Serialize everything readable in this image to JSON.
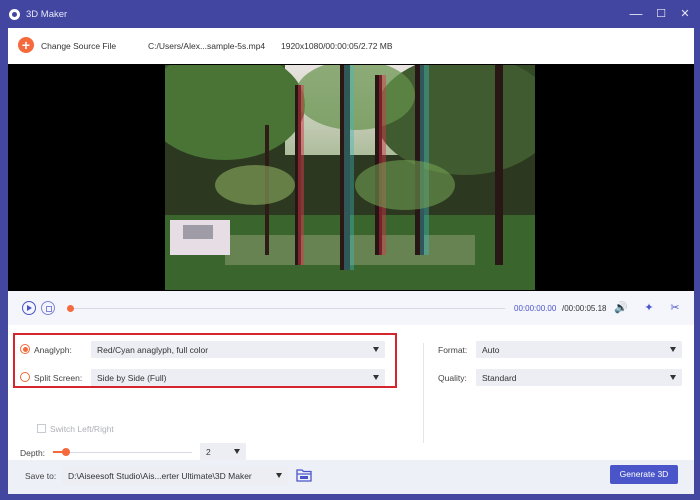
{
  "window": {
    "title": "3D Maker",
    "minimize_glyph": "—",
    "maximize_glyph": "☐",
    "close_glyph": "✕"
  },
  "toolbar": {
    "add_glyph": "+",
    "change_source_label": "Change Source File",
    "file_path": "C:/Users/Alex...sample-5s.mp4",
    "file_info": "1920x1080/00:00:05/2.72 MB"
  },
  "player": {
    "current_time": "00:00:00.00",
    "total_time": "/00:00:05.18",
    "progress": 0,
    "volume_glyph": "🔊",
    "effects_glyph": "✦",
    "cut_glyph": "✂"
  },
  "settings": {
    "anaglyph": {
      "label": "Anaglyph:",
      "selected": true,
      "value": "Red/Cyan anaglyph, full color"
    },
    "split_screen": {
      "label": "Split Screen:",
      "selected": false,
      "value": "Side by Side (Full)"
    },
    "switch_left_right": {
      "label": "Switch Left/Right",
      "checked": false,
      "enabled": false
    },
    "depth": {
      "label": "Depth:",
      "value": "2"
    },
    "format": {
      "label": "Format:",
      "value": "Auto"
    },
    "quality": {
      "label": "Quality:",
      "value": "Standard"
    }
  },
  "footer": {
    "save_to_label": "Save to:",
    "save_path": "D:\\Aiseesoft Studio\\Ais...erter Ultimate\\3D Maker",
    "generate_label": "Generate 3D"
  },
  "colors": {
    "accent": "#4a55c9",
    "orange": "#f46a3d",
    "highlight_box": "#d6262d",
    "title_bar": "#4246a0"
  }
}
